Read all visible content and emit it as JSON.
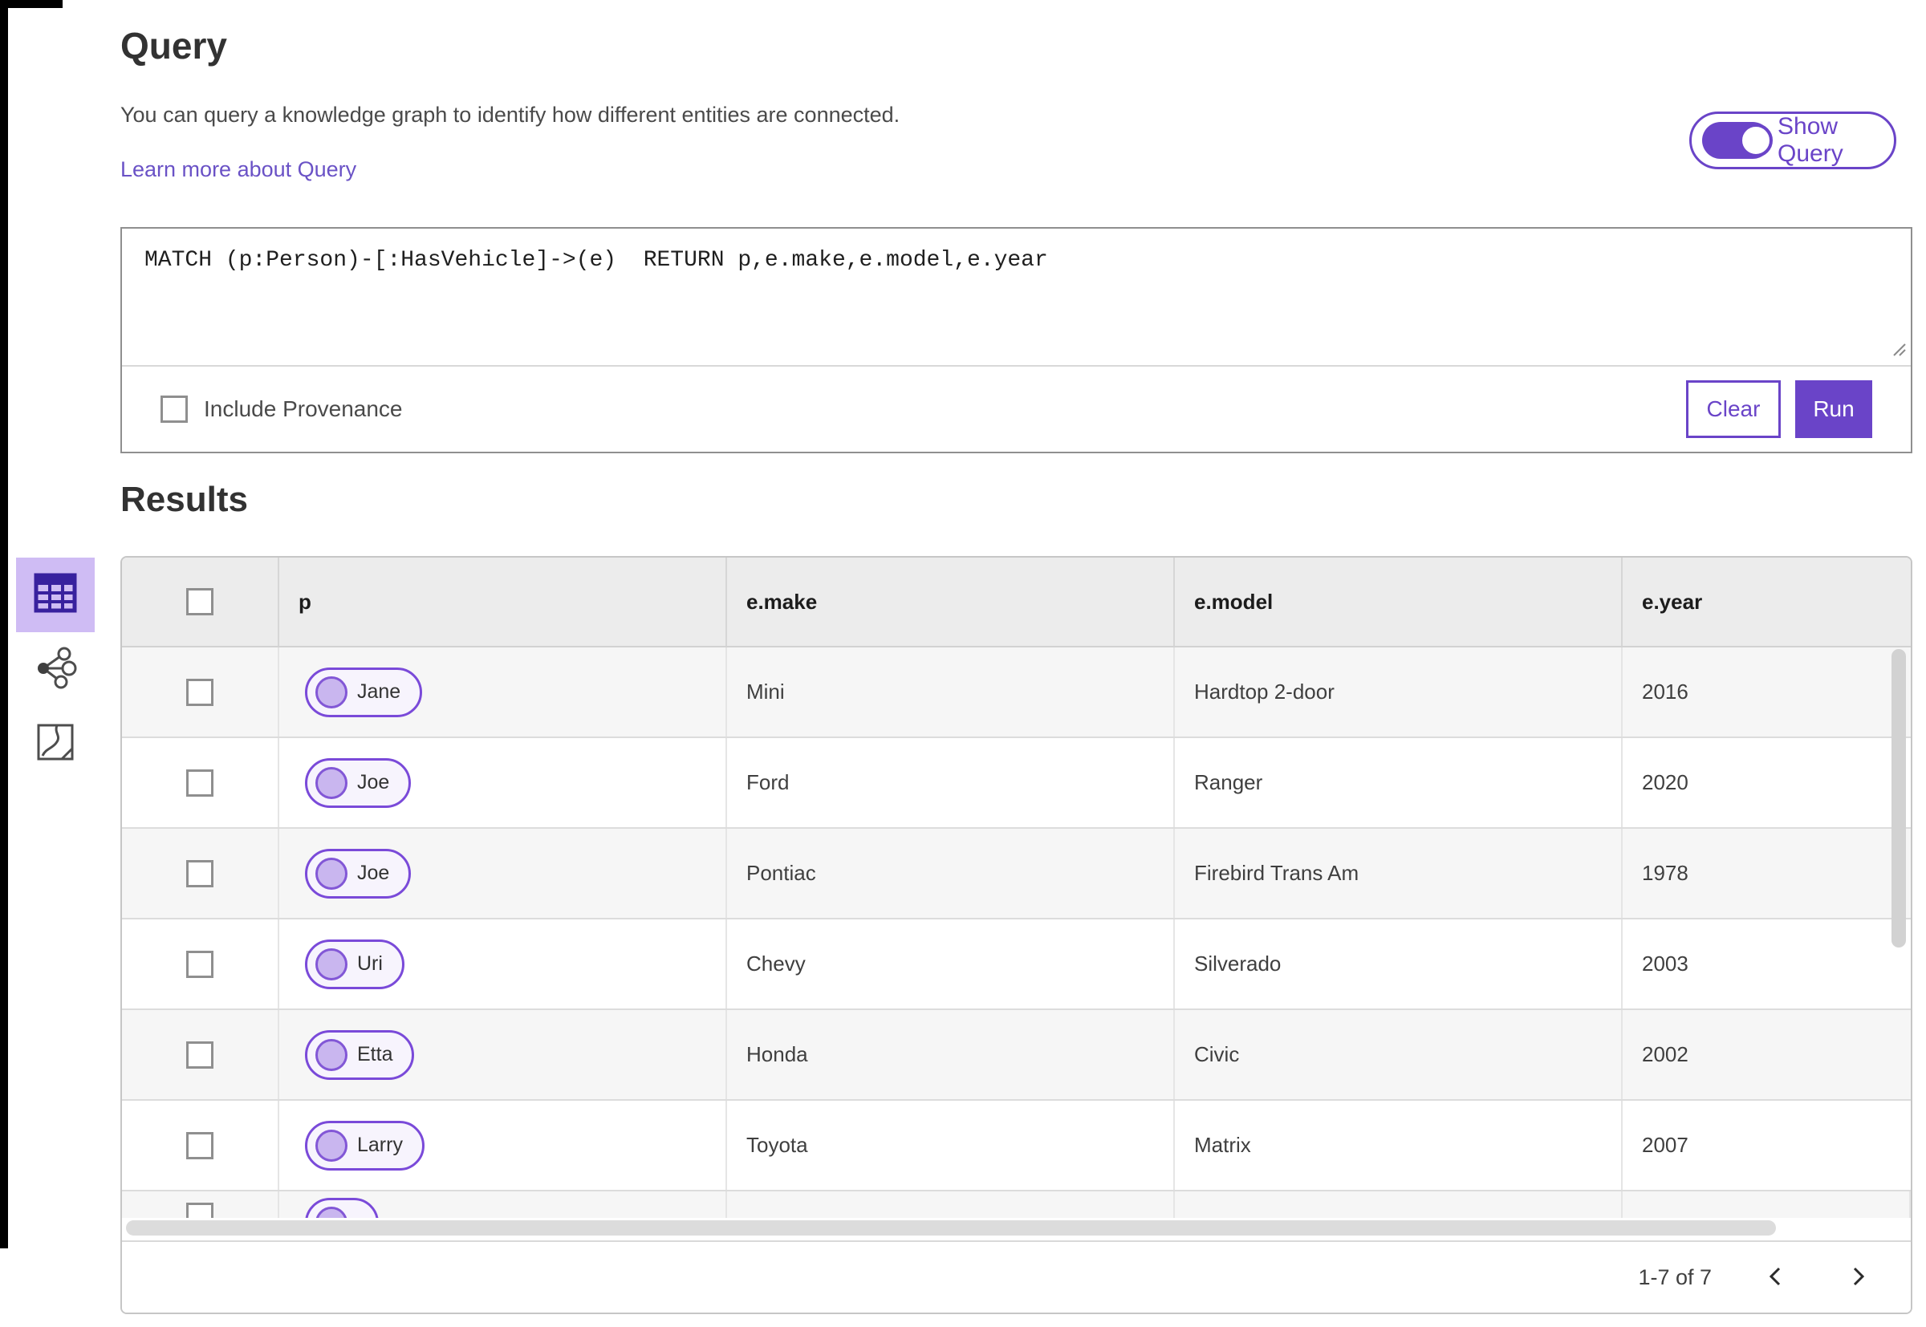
{
  "query_panel": {
    "title": "Query",
    "description": "You can query a knowledge graph to identify how different entities are connected.",
    "learn_more_label": "Learn more about Query",
    "show_query_label": "Show Query",
    "show_query_on": true,
    "query_text": "MATCH (p:Person)-[:HasVehicle]->(e)  RETURN p,e.make,e.model,e.year",
    "include_provenance_label": "Include Provenance",
    "include_provenance_checked": false,
    "clear_label": "Clear",
    "run_label": "Run"
  },
  "results": {
    "title": "Results",
    "view_icons": [
      {
        "name": "table-view-icon",
        "selected": true
      },
      {
        "name": "link-chart-view-icon",
        "selected": false
      },
      {
        "name": "map-view-icon",
        "selected": false
      }
    ],
    "columns": [
      "p",
      "e.make",
      "e.model",
      "e.year"
    ],
    "rows": [
      {
        "p": "Jane",
        "make": "Mini",
        "model": "Hardtop 2-door",
        "year": "2016"
      },
      {
        "p": "Joe",
        "make": "Ford",
        "model": "Ranger",
        "year": "2020"
      },
      {
        "p": "Joe",
        "make": "Pontiac",
        "model": "Firebird Trans Am",
        "year": "1978"
      },
      {
        "p": "Uri",
        "make": "Chevy",
        "model": "Silverado",
        "year": "2003"
      },
      {
        "p": "Etta",
        "make": "Honda",
        "model": "Civic",
        "year": "2002"
      },
      {
        "p": "Larry",
        "make": "Toyota",
        "model": "Matrix",
        "year": "2007"
      }
    ],
    "partial_row_visible": true,
    "pagination_label": "1-7 of 7"
  },
  "colors": {
    "accent": "#6a44c8",
    "chip_border": "#7a4ad9",
    "chip_fill": "#f7f4fd",
    "chip_circle": "#c9b6ef",
    "selected_view_bg": "#cfbcf4",
    "header_bg": "#ececec",
    "row_alt_bg": "#f6f6f6"
  }
}
